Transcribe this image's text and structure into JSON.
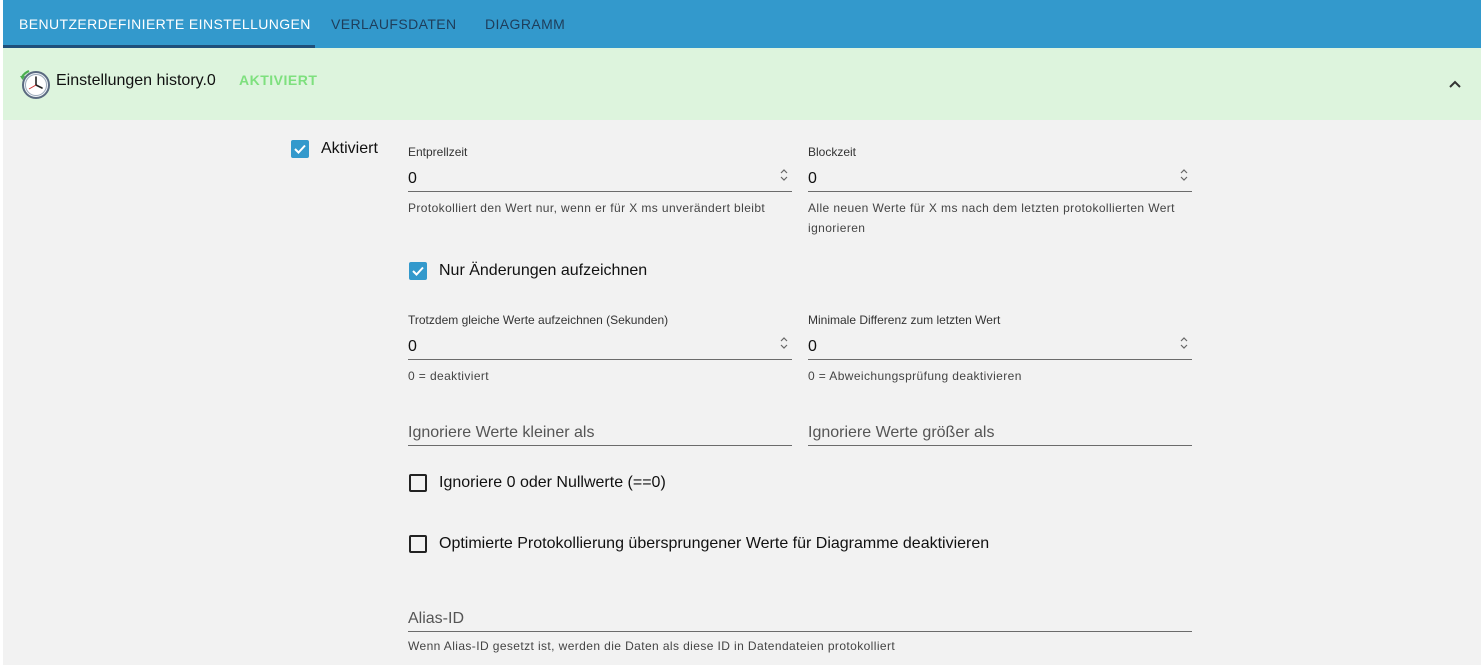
{
  "tabs": [
    {
      "label": "BENUTZERDEFINIERTE EINSTELLUNGEN",
      "active": true
    },
    {
      "label": "VERLAUFSDATEN",
      "active": false
    },
    {
      "label": "DIAGRAMM",
      "active": false
    }
  ],
  "header": {
    "icon": "history-clock-icon",
    "title": "Einstellungen history.0",
    "status": "AKTIVIERT",
    "status_color": "#7ee07e",
    "collapse_icon": "chevron-up-icon"
  },
  "colors": {
    "accent": "#3399cc",
    "header_bg": "#ddf4dd",
    "page_bg": "#f2f2f2"
  },
  "form": {
    "enabled": {
      "label": "Aktiviert",
      "checked": true
    },
    "debounce": {
      "label": "Entprellzeit",
      "value": "0",
      "help": "Protokolliert den Wert nur, wenn er für X ms unverändert bleibt"
    },
    "blocktime": {
      "label": "Blockzeit",
      "value": "0",
      "help": "Alle neuen Werte für X ms nach dem letzten protokollierten Wert ignorieren"
    },
    "changes_only": {
      "label": "Nur Änderungen aufzeichnen",
      "checked": true
    },
    "change_interval": {
      "label": "Trotzdem gleiche Werte aufzeichnen (Sekunden)",
      "value": "0",
      "help": "0 = deaktiviert"
    },
    "min_diff": {
      "label": "Minimale Differenz zum letzten Wert",
      "value": "0",
      "help": "0 = Abweichungsprüfung deaktivieren"
    },
    "ignore_below": {
      "placeholder": "Ignoriere Werte kleiner als",
      "value": ""
    },
    "ignore_above": {
      "placeholder": "Ignoriere Werte größer als",
      "value": ""
    },
    "ignore_zero": {
      "label": "Ignoriere 0 oder Nullwerte (==0)",
      "checked": false
    },
    "disable_skipped": {
      "label": "Optimierte Protokollierung übersprungener Werte für Diagramme deaktivieren",
      "checked": false
    },
    "alias_id": {
      "placeholder": "Alias-ID",
      "value": "",
      "help": "Wenn Alias-ID gesetzt ist, werden die Daten als diese ID in Datendateien protokolliert"
    }
  }
}
